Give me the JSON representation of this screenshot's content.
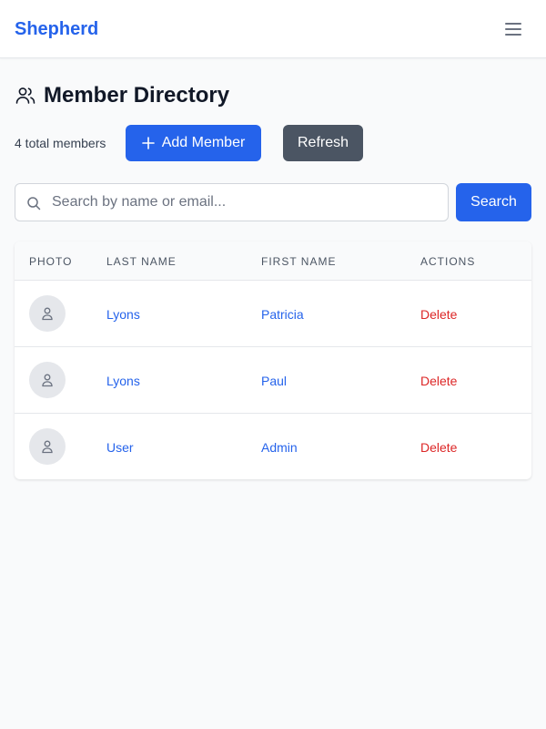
{
  "navbar": {
    "brand": "Shepherd",
    "menu_icon": "hamburger-menu-icon"
  },
  "page": {
    "title": "Member Directory",
    "title_icon": "users-icon",
    "total_count_text": "4 total members"
  },
  "toolbar": {
    "add_label": "Add Member",
    "add_icon": "plus-icon",
    "refresh_label": "Refresh"
  },
  "search": {
    "placeholder": "Search by name or email...",
    "value": "",
    "button_label": "Search",
    "icon": "search-icon"
  },
  "table": {
    "headers": {
      "photo": "Photo",
      "last_name": "Last Name",
      "first_name": "First Name",
      "actions": "Actions"
    },
    "rows": [
      {
        "last_name": "Lyons",
        "first_name": "Patricia",
        "action": "Delete"
      },
      {
        "last_name": "Lyons",
        "first_name": "Paul",
        "action": "Delete"
      },
      {
        "last_name": "User",
        "first_name": "Admin",
        "action": "Delete"
      }
    ]
  },
  "colors": {
    "primary": "#2563eb",
    "secondary": "#4b5563",
    "danger": "#dc2626",
    "background": "#f9fafb"
  }
}
